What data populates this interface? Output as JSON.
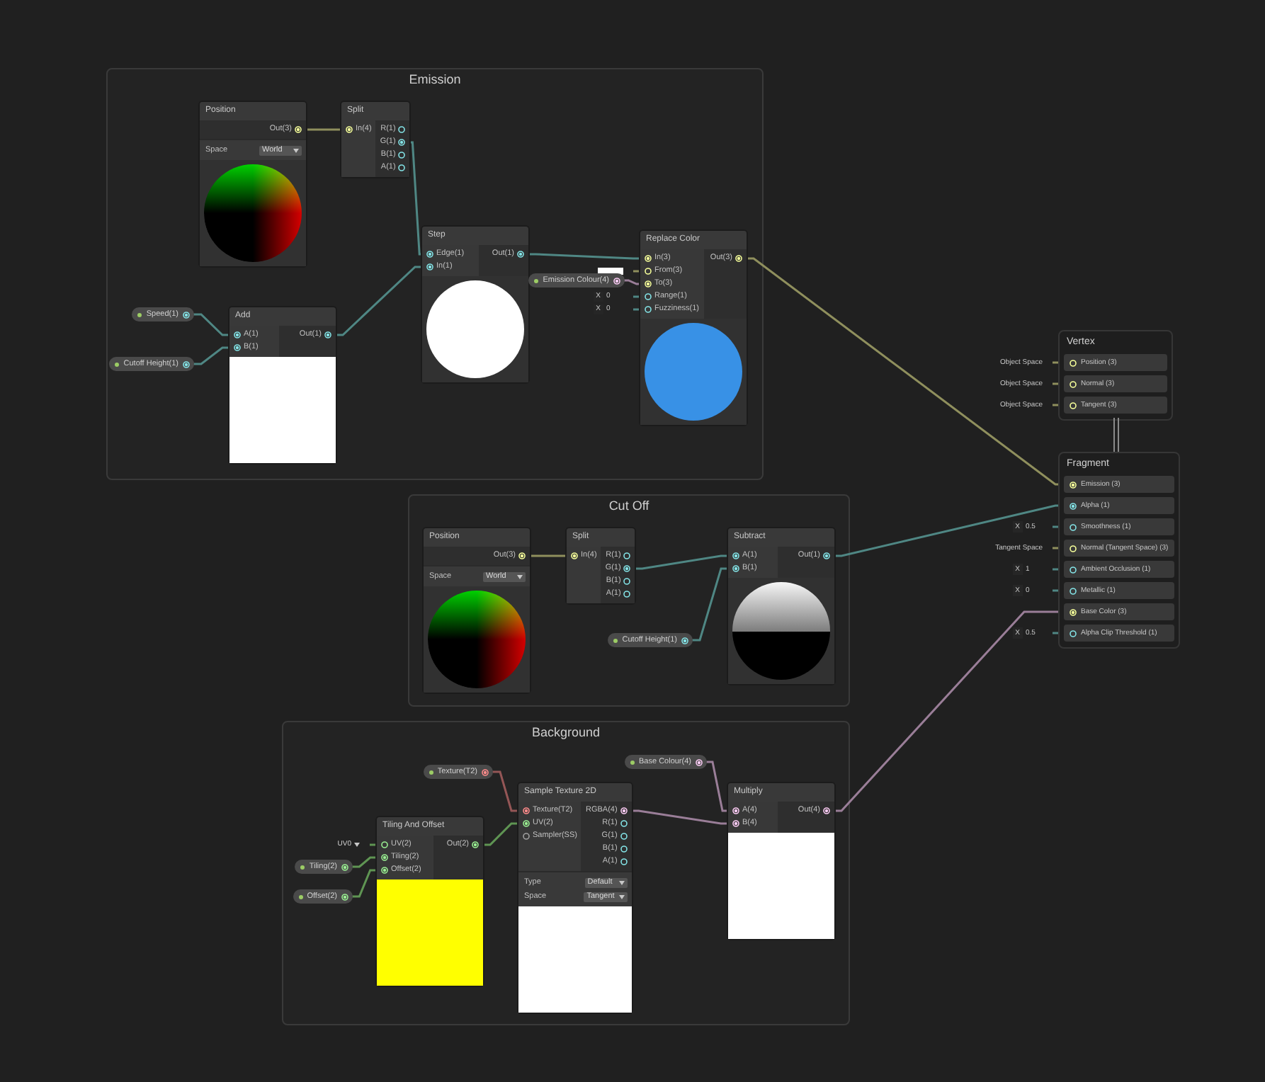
{
  "groups": [
    {
      "title": "Emission",
      "nodes": [
        {
          "title": "Position",
          "outputs": [
            {
              "label": "Out(3)",
              "kind": "vector3",
              "connected": true
            }
          ],
          "controls": [
            {
              "label": "Space",
              "value": "World"
            }
          ],
          "preview": {
            "kind": "quadrant-sphere"
          }
        },
        {
          "title": "Split",
          "inputs": [
            {
              "label": "In(4)",
              "kind": "vector3",
              "connected": true
            }
          ],
          "outputs": [
            {
              "label": "R(1)",
              "kind": "float",
              "connected": false
            },
            {
              "label": "G(1)",
              "kind": "float",
              "connected": true
            },
            {
              "label": "B(1)",
              "kind": "float",
              "connected": false
            },
            {
              "label": "A(1)",
              "kind": "float",
              "connected": false
            }
          ]
        },
        {
          "title": "Step",
          "inputs": [
            {
              "label": "Edge(1)",
              "kind": "float",
              "connected": true
            },
            {
              "label": "In(1)",
              "kind": "float",
              "connected": true
            }
          ],
          "outputs": [
            {
              "label": "Out(1)",
              "kind": "float",
              "connected": true
            }
          ],
          "preview": {
            "kind": "circle",
            "color": "#ffffff"
          }
        },
        {
          "title": "Replace Color",
          "inputs": [
            {
              "label": "In(3)",
              "kind": "vector3",
              "connected": true
            },
            {
              "label": "From(3)",
              "kind": "vector3",
              "connected": false,
              "inline": {
                "kind": "color",
                "color": "#ffffff"
              }
            },
            {
              "label": "To(3)",
              "kind": "vector3",
              "connected": true
            },
            {
              "label": "Range(1)",
              "kind": "float",
              "connected": false,
              "inline": {
                "kind": "float",
                "axis": "X",
                "value": "0"
              }
            },
            {
              "label": "Fuzziness(1)",
              "kind": "float",
              "connected": false,
              "inline": {
                "kind": "float",
                "axis": "X",
                "value": "0"
              }
            }
          ],
          "outputs": [
            {
              "label": "Out(3)",
              "kind": "vector3",
              "connected": true
            }
          ],
          "preview": {
            "kind": "circle",
            "color": "#3891e6"
          }
        },
        {
          "title": "Add",
          "inputs": [
            {
              "label": "A(1)",
              "kind": "float",
              "connected": true
            },
            {
              "label": "B(1)",
              "kind": "float",
              "connected": true
            }
          ],
          "outputs": [
            {
              "label": "Out(1)",
              "kind": "float",
              "connected": true
            }
          ],
          "preview": {
            "kind": "square",
            "color": "#ffffff"
          }
        }
      ],
      "properties": [
        {
          "label": "Speed(1)",
          "kind": "float"
        },
        {
          "label": "Cutoff Height(1)",
          "kind": "float"
        },
        {
          "label": "Emission Colour(4)",
          "kind": "vector4"
        }
      ]
    },
    {
      "title": "Cut Off",
      "nodes": [
        {
          "title": "Position",
          "outputs": [
            {
              "label": "Out(3)",
              "kind": "vector3",
              "connected": true
            }
          ],
          "controls": [
            {
              "label": "Space",
              "value": "World"
            }
          ],
          "preview": {
            "kind": "quadrant-sphere"
          }
        },
        {
          "title": "Split",
          "inputs": [
            {
              "label": "In(4)",
              "kind": "vector3",
              "connected": true
            }
          ],
          "outputs": [
            {
              "label": "R(1)",
              "kind": "float",
              "connected": false
            },
            {
              "label": "G(1)",
              "kind": "float",
              "connected": true
            },
            {
              "label": "B(1)",
              "kind": "float",
              "connected": false
            },
            {
              "label": "A(1)",
              "kind": "float",
              "connected": false
            }
          ]
        },
        {
          "title": "Subtract",
          "inputs": [
            {
              "label": "A(1)",
              "kind": "float",
              "connected": true
            },
            {
              "label": "B(1)",
              "kind": "float",
              "connected": true
            }
          ],
          "outputs": [
            {
              "label": "Out(1)",
              "kind": "float",
              "connected": true
            }
          ],
          "preview": {
            "kind": "gradient-sphere"
          }
        }
      ],
      "properties": [
        {
          "label": "Cutoff Height(1)",
          "kind": "float"
        }
      ]
    },
    {
      "title": "Background",
      "nodes": [
        {
          "title": "Tiling And Offset",
          "inputs": [
            {
              "label": "UV(2)",
              "kind": "vector2",
              "connected": false,
              "inline": {
                "kind": "dropdown",
                "value": "UV0"
              }
            },
            {
              "label": "Tiling(2)",
              "kind": "vector2",
              "connected": true
            },
            {
              "label": "Offset(2)",
              "kind": "vector2",
              "connected": true
            }
          ],
          "outputs": [
            {
              "label": "Out(2)",
              "kind": "vector2",
              "connected": true
            }
          ],
          "preview": {
            "kind": "square",
            "color": "#ffff00"
          }
        },
        {
          "title": "Sample Texture 2D",
          "inputs": [
            {
              "label": "Texture(T2)",
              "kind": "texture",
              "connected": true
            },
            {
              "label": "UV(2)",
              "kind": "vector2",
              "connected": true
            },
            {
              "label": "Sampler(SS)",
              "kind": "sampler",
              "connected": false
            }
          ],
          "outputs": [
            {
              "label": "RGBA(4)",
              "kind": "vector4",
              "connected": true
            },
            {
              "label": "R(1)",
              "kind": "float",
              "connected": false
            },
            {
              "label": "G(1)",
              "kind": "float",
              "connected": false
            },
            {
              "label": "B(1)",
              "kind": "float",
              "connected": false
            },
            {
              "label": "A(1)",
              "kind": "float",
              "connected": false
            }
          ],
          "controls": [
            {
              "label": "Type",
              "value": "Default"
            },
            {
              "label": "Space",
              "value": "Tangent"
            }
          ],
          "preview": {
            "kind": "square",
            "color": "#ffffff"
          }
        },
        {
          "title": "Multiply",
          "inputs": [
            {
              "label": "A(4)",
              "kind": "vector4",
              "connected": true
            },
            {
              "label": "B(4)",
              "kind": "vector4",
              "connected": true
            }
          ],
          "outputs": [
            {
              "label": "Out(4)",
              "kind": "vector4",
              "connected": true
            }
          ],
          "preview": {
            "kind": "square",
            "color": "#ffffff"
          }
        }
      ],
      "properties": [
        {
          "label": "Texture(T2)",
          "kind": "texture"
        },
        {
          "label": "Base Colour(4)",
          "kind": "vector4"
        },
        {
          "label": "Tiling(2)",
          "kind": "vector2"
        },
        {
          "label": "Offset(2)",
          "kind": "vector2"
        }
      ]
    }
  ],
  "master_stack": {
    "blocks": [
      {
        "title": "Vertex",
        "slots": [
          {
            "label": "Position (3)",
            "kind": "vector3",
            "connected": false,
            "inline": {
              "kind": "space",
              "value": "Object Space"
            }
          },
          {
            "label": "Normal (3)",
            "kind": "vector3",
            "connected": false,
            "inline": {
              "kind": "space",
              "value": "Object Space"
            }
          },
          {
            "label": "Tangent (3)",
            "kind": "vector3",
            "connected": false,
            "inline": {
              "kind": "space",
              "value": "Object Space"
            }
          }
        ]
      },
      {
        "title": "Fragment",
        "slots": [
          {
            "label": "Emission (3)",
            "kind": "vector3",
            "connected": true
          },
          {
            "label": "Alpha (1)",
            "kind": "float",
            "connected": true
          },
          {
            "label": "Smoothness (1)",
            "kind": "float",
            "connected": false,
            "inline": {
              "kind": "float",
              "axis": "X",
              "value": "0.5"
            }
          },
          {
            "label": "Normal (Tangent Space) (3)",
            "kind": "vector3",
            "connected": false,
            "inline": {
              "kind": "space",
              "value": "Tangent Space"
            }
          },
          {
            "label": "Ambient Occlusion (1)",
            "kind": "float",
            "connected": false,
            "inline": {
              "kind": "float",
              "axis": "X",
              "value": "1"
            }
          },
          {
            "label": "Metallic (1)",
            "kind": "float",
            "connected": false,
            "inline": {
              "kind": "float",
              "axis": "X",
              "value": "0"
            }
          },
          {
            "label": "Base Color (3)",
            "kind": "vector3",
            "connected": true
          },
          {
            "label": "Alpha Clip Threshold (1)",
            "kind": "float",
            "connected": false,
            "inline": {
              "kind": "float",
              "axis": "X",
              "value": "0.5"
            }
          }
        ]
      }
    ]
  }
}
